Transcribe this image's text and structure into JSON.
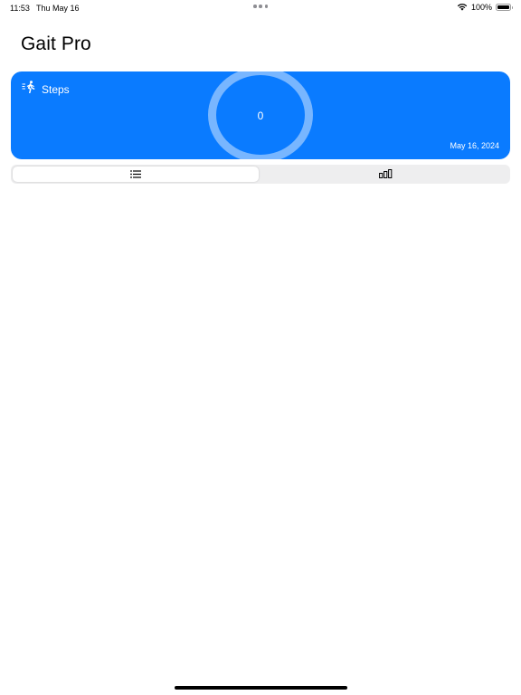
{
  "status_bar": {
    "time": "11:53",
    "date": "Thu May 16",
    "battery_percent": "100%",
    "battery_level": 1.0,
    "icons": [
      "multitasking-dots",
      "wifi-icon",
      "battery-icon"
    ]
  },
  "header": {
    "title": "Gait Pro"
  },
  "steps_card": {
    "label": "Steps",
    "icon": "walking-figure-icon",
    "count": "0",
    "date": "May 16, 2024",
    "background_color": "#0a7bff"
  },
  "view_toggle": {
    "selected": "list",
    "options": [
      {
        "icon": "list-icon"
      },
      {
        "icon": "bar-chart-icon"
      }
    ]
  }
}
